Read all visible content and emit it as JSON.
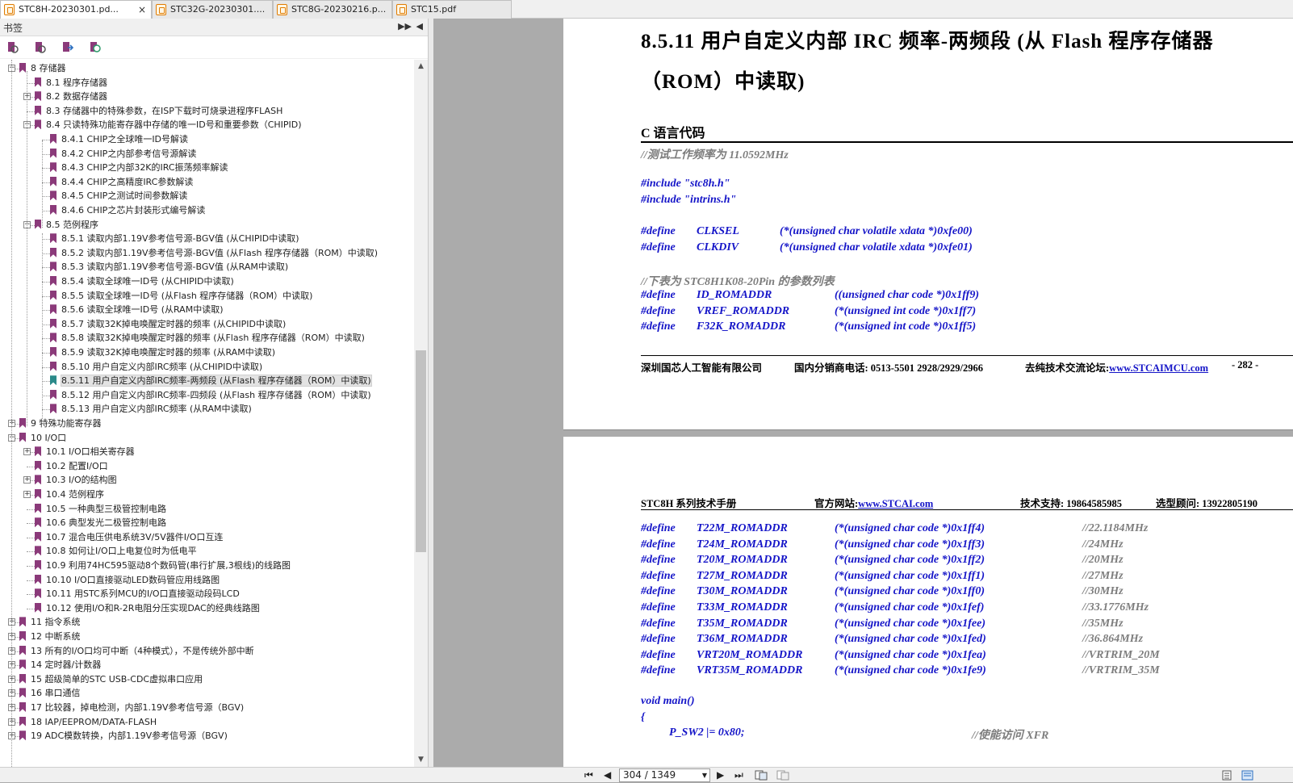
{
  "tabs": [
    {
      "label": "STC8H-20230301.pd...",
      "close": "×",
      "active": true
    },
    {
      "label": "STC32G-20230301....",
      "active": false
    },
    {
      "label": "STC8G-20230216.p...",
      "active": false
    },
    {
      "label": "STC15.pdf",
      "active": false
    }
  ],
  "sidebar": {
    "title": "书签",
    "collapse_label": "◀",
    "expand_label": "▶▶"
  },
  "toolbar_icons": [
    "bookmark-expand-icon",
    "bookmark-collapse-icon",
    "bookmark-goto-icon",
    "bookmark-search-icon"
  ],
  "tree": [
    {
      "level": 0,
      "exp": "−",
      "label": "8 存储器"
    },
    {
      "level": 1,
      "exp": "",
      "label": "8.1 程序存储器"
    },
    {
      "level": 1,
      "exp": "+",
      "label": "8.2 数据存储器"
    },
    {
      "level": 1,
      "exp": "",
      "label": "8.3 存储器中的特殊参数，在ISP下载时可烧录进程序FLASH"
    },
    {
      "level": 1,
      "exp": "−",
      "label": "8.4 只读特殊功能寄存器中存储的唯一ID号和重要参数（CHIPID)"
    },
    {
      "level": 2,
      "exp": "",
      "label": "8.4.1 CHIP之全球唯一ID号解读"
    },
    {
      "level": 2,
      "exp": "",
      "label": "8.4.2 CHIP之内部参考信号源解读"
    },
    {
      "level": 2,
      "exp": "",
      "label": "8.4.3 CHIP之内部32K的IRC振荡频率解读"
    },
    {
      "level": 2,
      "exp": "",
      "label": "8.4.4 CHIP之高精度IRC参数解读"
    },
    {
      "level": 2,
      "exp": "",
      "label": "8.4.5 CHIP之测试时间参数解读"
    },
    {
      "level": 2,
      "exp": "",
      "label": "8.4.6 CHIP之芯片封装形式编号解读"
    },
    {
      "level": 1,
      "exp": "−",
      "label": "8.5 范例程序"
    },
    {
      "level": 2,
      "exp": "",
      "label": "8.5.1 读取内部1.19V参考信号源-BGV值 (从CHIPID中读取)"
    },
    {
      "level": 2,
      "exp": "",
      "label": "8.5.2 读取内部1.19V参考信号源-BGV值 (从Flash 程序存储器（ROM）中读取)"
    },
    {
      "level": 2,
      "exp": "",
      "label": "8.5.3 读取内部1.19V参考信号源-BGV值 (从RAM中读取)"
    },
    {
      "level": 2,
      "exp": "",
      "label": "8.5.4 读取全球唯一ID号 (从CHIPID中读取)"
    },
    {
      "level": 2,
      "exp": "",
      "label": "8.5.5 读取全球唯一ID号 (从Flash 程序存储器（ROM）中读取)"
    },
    {
      "level": 2,
      "exp": "",
      "label": "8.5.6 读取全球唯一ID号 (从RAM中读取)"
    },
    {
      "level": 2,
      "exp": "",
      "label": "8.5.7 读取32K掉电唤醒定时器的频率 (从CHIPID中读取)"
    },
    {
      "level": 2,
      "exp": "",
      "label": "8.5.8 读取32K掉电唤醒定时器的频率 (从Flash 程序存储器（ROM）中读取)"
    },
    {
      "level": 2,
      "exp": "",
      "label": "8.5.9 读取32K掉电唤醒定时器的频率 (从RAM中读取)"
    },
    {
      "level": 2,
      "exp": "",
      "label": "8.5.10 用户自定义内部IRC频率 (从CHIPID中读取)"
    },
    {
      "level": 2,
      "exp": "",
      "label": "8.5.11 用户自定义内部IRC频率-两频段 (从Flash 程序存储器（ROM）中读取)",
      "selected": true
    },
    {
      "level": 2,
      "exp": "",
      "label": "8.5.12 用户自定义内部IRC频率-四频段 (从Flash 程序存储器（ROM）中读取)"
    },
    {
      "level": 2,
      "exp": "",
      "label": "8.5.13 用户自定义内部IRC频率 (从RAM中读取)"
    },
    {
      "level": 0,
      "exp": "+",
      "label": "9 特殊功能寄存器"
    },
    {
      "level": 0,
      "exp": "−",
      "label": "10 I/O口"
    },
    {
      "level": 1,
      "exp": "+",
      "label": "10.1 I/O口相关寄存器"
    },
    {
      "level": 1,
      "exp": "",
      "label": "10.2 配置I/O口"
    },
    {
      "level": 1,
      "exp": "+",
      "label": "10.3 I/O的结构图"
    },
    {
      "level": 1,
      "exp": "+",
      "label": "10.4 范例程序"
    },
    {
      "level": 1,
      "exp": "",
      "label": "10.5 一种典型三极管控制电路"
    },
    {
      "level": 1,
      "exp": "",
      "label": "10.6 典型发光二极管控制电路"
    },
    {
      "level": 1,
      "exp": "",
      "label": "10.7 混合电压供电系统3V/5V器件I/O口互连"
    },
    {
      "level": 1,
      "exp": "",
      "label": "10.8 如何让I/O口上电复位时为低电平"
    },
    {
      "level": 1,
      "exp": "",
      "label": "10.9 利用74HC595驱动8个数码管(串行扩展,3根线)的线路图"
    },
    {
      "level": 1,
      "exp": "",
      "label": "10.10 I/O口直接驱动LED数码管应用线路图"
    },
    {
      "level": 1,
      "exp": "",
      "label": "10.11 用STC系列MCU的I/O口直接驱动段码LCD"
    },
    {
      "level": 1,
      "exp": "",
      "label": "10.12 使用I/O和R-2R电阻分压实现DAC的经典线路图"
    },
    {
      "level": 0,
      "exp": "+",
      "label": "11 指令系统"
    },
    {
      "level": 0,
      "exp": "+",
      "label": "12 中断系统"
    },
    {
      "level": 0,
      "exp": "+",
      "label": "13 所有的I/O口均可中断（4种模式），不是传统外部中断"
    },
    {
      "level": 0,
      "exp": "+",
      "label": "14 定时器/计数器"
    },
    {
      "level": 0,
      "exp": "+",
      "label": "15 超级简单的STC USB-CDC虚拟串口应用"
    },
    {
      "level": 0,
      "exp": "+",
      "label": "16 串口通信"
    },
    {
      "level": 0,
      "exp": "+",
      "label": "17 比较器，掉电检测，内部1.19V参考信号源（BGV)"
    },
    {
      "level": 0,
      "exp": "+",
      "label": "18 IAP/EEPROM/DATA-FLASH"
    },
    {
      "level": 0,
      "exp": "+",
      "label": "19 ADC模数转换，内部1.19V参考信号源（BGV)"
    }
  ],
  "page1": {
    "heading_line1": "8.5.11 用户自定义内部 IRC 频率-两频段 (从 Flash 程序存储器",
    "heading_line2": "（ROM）中读取)",
    "section": "C 语言代码",
    "comment1": "//测试工作频率为 11.0592MHz",
    "include1": "#include \"stc8h.h\"",
    "include2": "#include \"intrins.h\"",
    "defines1": [
      {
        "kw": "#define",
        "name": "CLKSEL",
        "val": "(*(unsigned char volatile xdata *)0xfe00)"
      },
      {
        "kw": "#define",
        "name": "CLKDIV",
        "val": "(*(unsigned char volatile xdata *)0xfe01)"
      }
    ],
    "comment2": "//下表为 STC8H1K08-20Pin 的参数列表",
    "defines2": [
      {
        "kw": "#define",
        "name": "ID_ROMADDR",
        "val": "((unsigned char code *)0x1ff9)"
      },
      {
        "kw": "#define",
        "name": "VREF_ROMADDR",
        "val": "(*(unsigned int code *)0x1ff7)"
      },
      {
        "kw": "#define",
        "name": "F32K_ROMADDR",
        "val": "(*(unsigned int code *)0x1ff5)"
      }
    ],
    "footer": {
      "company": "深圳国芯人工智能有限公司",
      "phone": "国内分销商电话: 0513-5501 2928/2929/2966",
      "forum_label": "去纯技术交流论坛:",
      "forum_link": "www.STCAIMCU.com",
      "page": "- 282 -"
    }
  },
  "page2": {
    "header": {
      "manual": "STC8H 系列技术手册",
      "site_label": "官方网站:",
      "site_link": "www.STCAI.com",
      "support": "技术支持: 19864585985",
      "consult": "选型顾问: 13922805190"
    },
    "defines": [
      {
        "kw": "#define",
        "name": "T22M_ROMADDR",
        "val": "(*(unsigned char code *)0x1ff4)",
        "cmt": "//22.1184MHz"
      },
      {
        "kw": "#define",
        "name": "T24M_ROMADDR",
        "val": "(*(unsigned char code *)0x1ff3)",
        "cmt": "//24MHz"
      },
      {
        "kw": "#define",
        "name": "T20M_ROMADDR",
        "val": "(*(unsigned char code *)0x1ff2)",
        "cmt": "//20MHz"
      },
      {
        "kw": "#define",
        "name": "T27M_ROMADDR",
        "val": "(*(unsigned char code *)0x1ff1)",
        "cmt": "//27MHz"
      },
      {
        "kw": "#define",
        "name": "T30M_ROMADDR",
        "val": "(*(unsigned char code *)0x1ff0)",
        "cmt": "//30MHz"
      },
      {
        "kw": "#define",
        "name": "T33M_ROMADDR",
        "val": "(*(unsigned char code *)0x1fef)",
        "cmt": "//33.1776MHz"
      },
      {
        "kw": "#define",
        "name": "T35M_ROMADDR",
        "val": "(*(unsigned char code *)0x1fee)",
        "cmt": "//35MHz"
      },
      {
        "kw": "#define",
        "name": "T36M_ROMADDR",
        "val": "(*(unsigned char code *)0x1fed)",
        "cmt": "//36.864MHz"
      },
      {
        "kw": "#define",
        "name": "VRT20M_ROMADDR",
        "val": "(*(unsigned char code *)0x1fea)",
        "cmt": "//VRTRIM_20M"
      },
      {
        "kw": "#define",
        "name": "VRT35M_ROMADDR",
        "val": "(*(unsigned char code *)0x1fe9)",
        "cmt": "//VRTRIM_35M"
      }
    ],
    "main": "void main()",
    "brace": "{",
    "stmt": "P_SW2 |= 0x80;",
    "stmt_cmt": "//使能访问 XFR"
  },
  "statusbar": {
    "page_value": "304 / 1349",
    "first": "⏮",
    "prev": "◀",
    "next": "▶",
    "last": "⏭"
  }
}
